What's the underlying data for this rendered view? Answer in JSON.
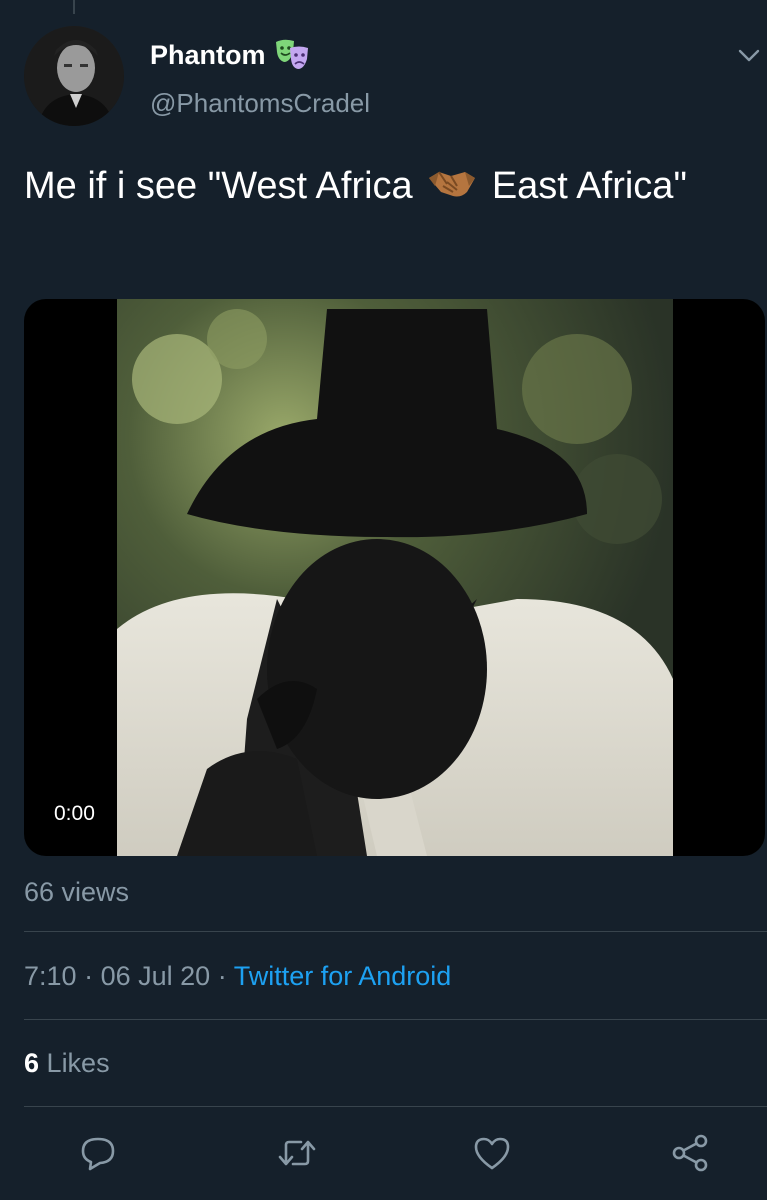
{
  "author": {
    "display_name": "Phantom",
    "handle": "@PhantomsCradel",
    "badge_icon": "theater-masks-icon"
  },
  "tweet": {
    "text_part1": "Me if i see \"West Africa",
    "emoji_icon": "handshake-icon",
    "text_part2": "East Africa\""
  },
  "video": {
    "timestamp": "0:00"
  },
  "stats": {
    "views": "66 views",
    "time": "7:10",
    "date": "06 Jul 20",
    "separator": "·",
    "source": "Twitter for Android",
    "likes_count": "6",
    "likes_label": "Likes"
  },
  "colors": {
    "background": "#15202b",
    "divider": "#38444d",
    "muted_text": "#8899a6",
    "link": "#1da1f2"
  },
  "actions": [
    "reply-icon",
    "retweet-icon",
    "like-icon",
    "share-icon"
  ]
}
